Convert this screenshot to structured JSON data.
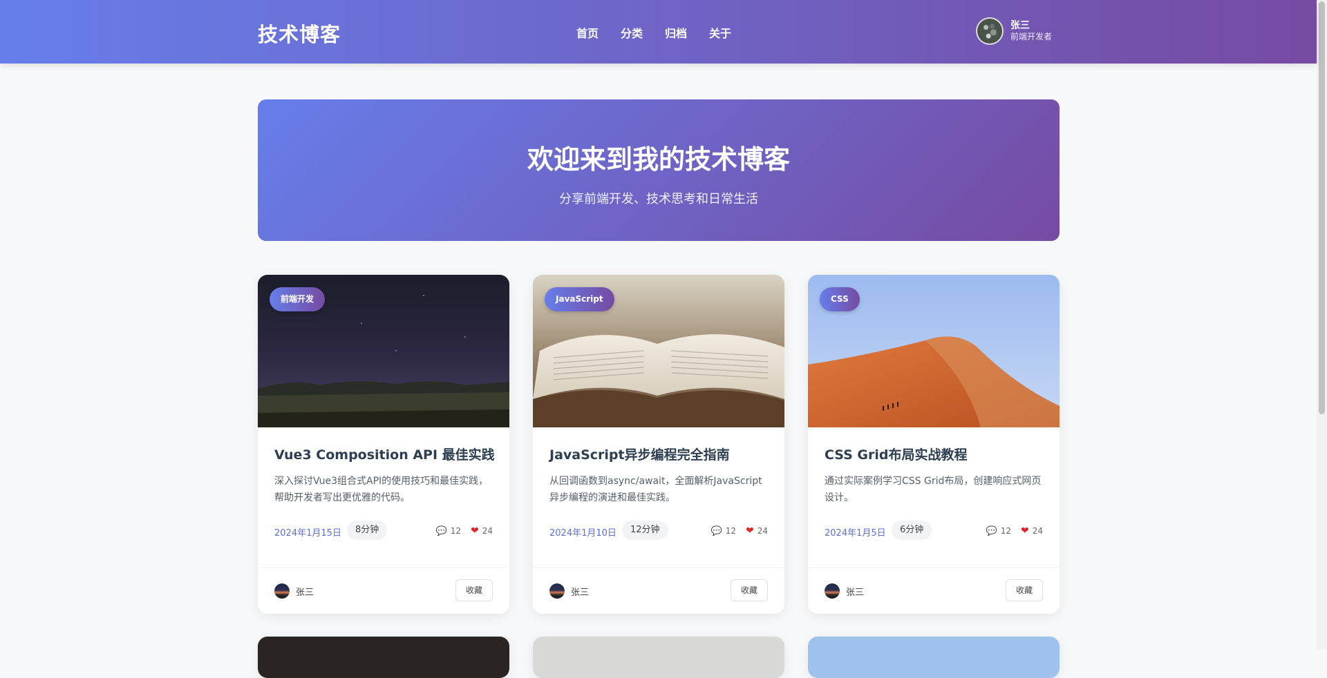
{
  "site": {
    "logo": "技术博客",
    "nav": [
      "首页",
      "分类",
      "归档",
      "关于"
    ],
    "user": {
      "name": "张三",
      "role": "前端开发者"
    }
  },
  "hero": {
    "title": "欢迎来到我的技术博客",
    "subtitle": "分享前端开发、技术思考和日常生活"
  },
  "posts": [
    {
      "tag": "前端开发",
      "title": "Vue3 Composition API 最佳实践",
      "desc": "深入探讨Vue3组合式API的使用技巧和最佳实践，帮助开发者写出更优雅的代码。",
      "date": "2024年1月15日",
      "read_time": "8分钟",
      "comments": "12",
      "likes": "24",
      "author": "张三",
      "favorite_label": "收藏",
      "image": "night-sky-icon"
    },
    {
      "tag": "JavaScript",
      "title": "JavaScript异步编程完全指南",
      "desc": "从回调函数到async/await，全面解析JavaScript异步编程的演进和最佳实践。",
      "date": "2024年1月10日",
      "read_time": "12分钟",
      "comments": "12",
      "likes": "24",
      "author": "张三",
      "favorite_label": "收藏",
      "image": "open-book-icon"
    },
    {
      "tag": "CSS",
      "title": "CSS Grid布局实战教程",
      "desc": "通过实际案例学习CSS Grid布局，创建响应式网页设计。",
      "date": "2024年1月5日",
      "read_time": "6分钟",
      "comments": "12",
      "likes": "24",
      "author": "张三",
      "favorite_label": "收藏",
      "image": "desert-dune-icon"
    }
  ],
  "colors": {
    "brand_start": "#667eea",
    "brand_end": "#764ba2",
    "date": "#5b6fd8",
    "heart": "#e0242a"
  }
}
